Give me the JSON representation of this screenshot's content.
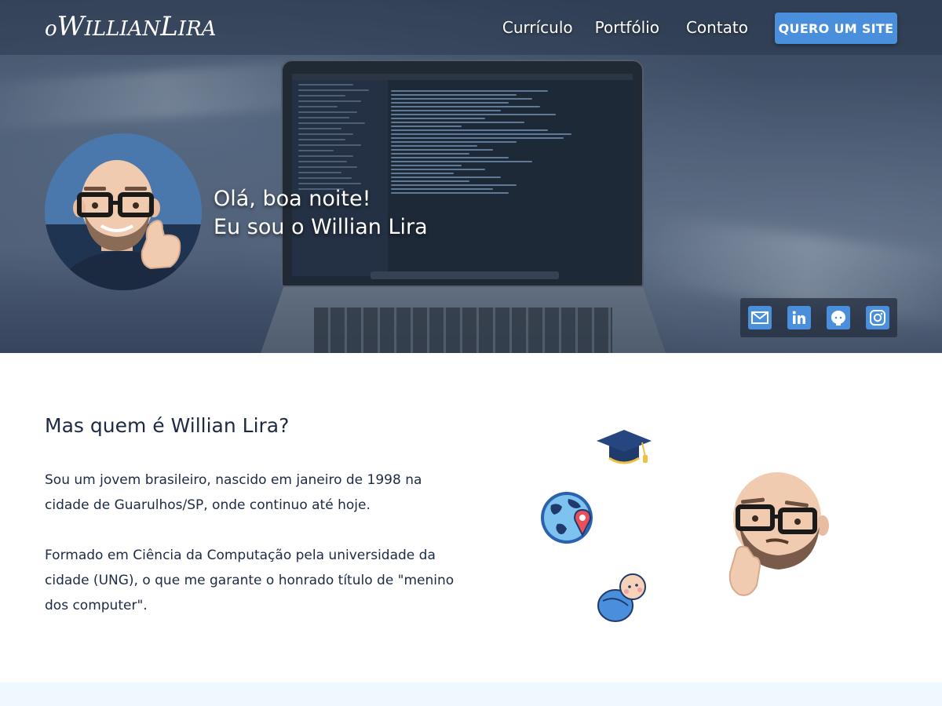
{
  "header": {
    "logo": {
      "prefix": "o",
      "first_initial": "W",
      "first_rest": "ILLIAN",
      "last_initial": "L",
      "last_rest": "IRA"
    },
    "nav": [
      {
        "label": "Currículo"
      },
      {
        "label": "Portfólio"
      },
      {
        "label": "Contato"
      }
    ],
    "cta_label": "QUERO UM SITE"
  },
  "hero": {
    "greeting_line1": "Olá, boa noite!",
    "greeting_line2": "Eu sou o Willian Lira",
    "social_icons": [
      "mail-icon",
      "linkedin-icon",
      "github-icon",
      "instagram-icon"
    ]
  },
  "about": {
    "title": "Mas quem é Willian Lira?",
    "paragraph1": "Sou um jovem brasileiro, nascido em janeiro de 1998 na cidade de Guarulhos/SP, onde continuo até hoje.",
    "paragraph2": "Formado em Ciência da Computação pela universidade da cidade (UNG), o que me garante o honrado título de \"menino dos computer\".",
    "illustration_icons": [
      "graduation-cap-icon",
      "globe-pin-icon",
      "baby-icon",
      "thinking-memoji"
    ]
  },
  "colors": {
    "accent": "#4a8fdc",
    "text_dark": "#1c2a44",
    "footer_strip": "#eef8fe"
  }
}
